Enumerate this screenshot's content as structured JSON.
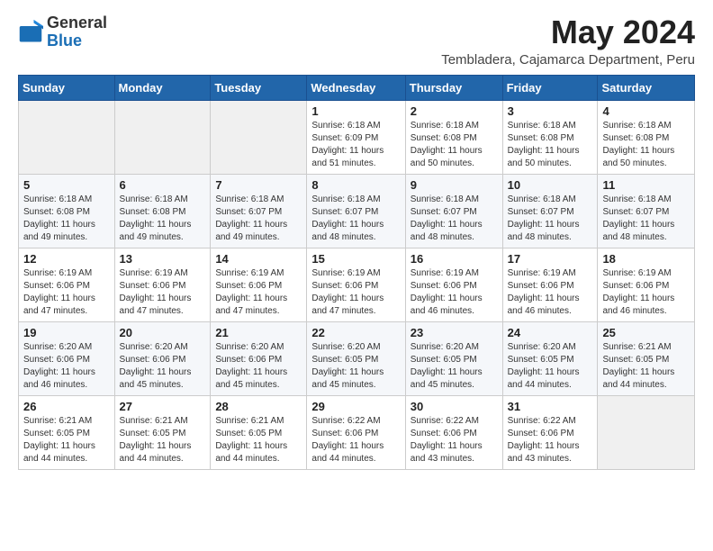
{
  "header": {
    "logo_general": "General",
    "logo_blue": "Blue",
    "month_title": "May 2024",
    "location": "Tembladera, Cajamarca Department, Peru"
  },
  "weekdays": [
    "Sunday",
    "Monday",
    "Tuesday",
    "Wednesday",
    "Thursday",
    "Friday",
    "Saturday"
  ],
  "weeks": [
    [
      {
        "day": "",
        "info": ""
      },
      {
        "day": "",
        "info": ""
      },
      {
        "day": "",
        "info": ""
      },
      {
        "day": "1",
        "info": "Sunrise: 6:18 AM\nSunset: 6:09 PM\nDaylight: 11 hours\nand 51 minutes."
      },
      {
        "day": "2",
        "info": "Sunrise: 6:18 AM\nSunset: 6:08 PM\nDaylight: 11 hours\nand 50 minutes."
      },
      {
        "day": "3",
        "info": "Sunrise: 6:18 AM\nSunset: 6:08 PM\nDaylight: 11 hours\nand 50 minutes."
      },
      {
        "day": "4",
        "info": "Sunrise: 6:18 AM\nSunset: 6:08 PM\nDaylight: 11 hours\nand 50 minutes."
      }
    ],
    [
      {
        "day": "5",
        "info": "Sunrise: 6:18 AM\nSunset: 6:08 PM\nDaylight: 11 hours\nand 49 minutes."
      },
      {
        "day": "6",
        "info": "Sunrise: 6:18 AM\nSunset: 6:08 PM\nDaylight: 11 hours\nand 49 minutes."
      },
      {
        "day": "7",
        "info": "Sunrise: 6:18 AM\nSunset: 6:07 PM\nDaylight: 11 hours\nand 49 minutes."
      },
      {
        "day": "8",
        "info": "Sunrise: 6:18 AM\nSunset: 6:07 PM\nDaylight: 11 hours\nand 48 minutes."
      },
      {
        "day": "9",
        "info": "Sunrise: 6:18 AM\nSunset: 6:07 PM\nDaylight: 11 hours\nand 48 minutes."
      },
      {
        "day": "10",
        "info": "Sunrise: 6:18 AM\nSunset: 6:07 PM\nDaylight: 11 hours\nand 48 minutes."
      },
      {
        "day": "11",
        "info": "Sunrise: 6:18 AM\nSunset: 6:07 PM\nDaylight: 11 hours\nand 48 minutes."
      }
    ],
    [
      {
        "day": "12",
        "info": "Sunrise: 6:19 AM\nSunset: 6:06 PM\nDaylight: 11 hours\nand 47 minutes."
      },
      {
        "day": "13",
        "info": "Sunrise: 6:19 AM\nSunset: 6:06 PM\nDaylight: 11 hours\nand 47 minutes."
      },
      {
        "day": "14",
        "info": "Sunrise: 6:19 AM\nSunset: 6:06 PM\nDaylight: 11 hours\nand 47 minutes."
      },
      {
        "day": "15",
        "info": "Sunrise: 6:19 AM\nSunset: 6:06 PM\nDaylight: 11 hours\nand 47 minutes."
      },
      {
        "day": "16",
        "info": "Sunrise: 6:19 AM\nSunset: 6:06 PM\nDaylight: 11 hours\nand 46 minutes."
      },
      {
        "day": "17",
        "info": "Sunrise: 6:19 AM\nSunset: 6:06 PM\nDaylight: 11 hours\nand 46 minutes."
      },
      {
        "day": "18",
        "info": "Sunrise: 6:19 AM\nSunset: 6:06 PM\nDaylight: 11 hours\nand 46 minutes."
      }
    ],
    [
      {
        "day": "19",
        "info": "Sunrise: 6:20 AM\nSunset: 6:06 PM\nDaylight: 11 hours\nand 46 minutes."
      },
      {
        "day": "20",
        "info": "Sunrise: 6:20 AM\nSunset: 6:06 PM\nDaylight: 11 hours\nand 45 minutes."
      },
      {
        "day": "21",
        "info": "Sunrise: 6:20 AM\nSunset: 6:06 PM\nDaylight: 11 hours\nand 45 minutes."
      },
      {
        "day": "22",
        "info": "Sunrise: 6:20 AM\nSunset: 6:05 PM\nDaylight: 11 hours\nand 45 minutes."
      },
      {
        "day": "23",
        "info": "Sunrise: 6:20 AM\nSunset: 6:05 PM\nDaylight: 11 hours\nand 45 minutes."
      },
      {
        "day": "24",
        "info": "Sunrise: 6:20 AM\nSunset: 6:05 PM\nDaylight: 11 hours\nand 44 minutes."
      },
      {
        "day": "25",
        "info": "Sunrise: 6:21 AM\nSunset: 6:05 PM\nDaylight: 11 hours\nand 44 minutes."
      }
    ],
    [
      {
        "day": "26",
        "info": "Sunrise: 6:21 AM\nSunset: 6:05 PM\nDaylight: 11 hours\nand 44 minutes."
      },
      {
        "day": "27",
        "info": "Sunrise: 6:21 AM\nSunset: 6:05 PM\nDaylight: 11 hours\nand 44 minutes."
      },
      {
        "day": "28",
        "info": "Sunrise: 6:21 AM\nSunset: 6:05 PM\nDaylight: 11 hours\nand 44 minutes."
      },
      {
        "day": "29",
        "info": "Sunrise: 6:22 AM\nSunset: 6:06 PM\nDaylight: 11 hours\nand 44 minutes."
      },
      {
        "day": "30",
        "info": "Sunrise: 6:22 AM\nSunset: 6:06 PM\nDaylight: 11 hours\nand 43 minutes."
      },
      {
        "day": "31",
        "info": "Sunrise: 6:22 AM\nSunset: 6:06 PM\nDaylight: 11 hours\nand 43 minutes."
      },
      {
        "day": "",
        "info": ""
      }
    ]
  ]
}
